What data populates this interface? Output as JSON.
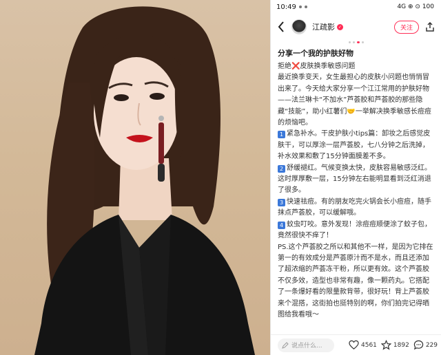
{
  "status_bar": {
    "time": "10:49",
    "right_indicators": "4G ⊕ ⊙ 100"
  },
  "header": {
    "author_name": "江疏影",
    "follow_label": "关注"
  },
  "post": {
    "title": "分享一个我的护肤好物",
    "paragraphs": [
      {
        "pre": "拒绝",
        "emoji": "❌",
        "text": "皮肤换季敏感问题"
      },
      {
        "text": "最近换季变天，女生最担心的皮肤小问题也悄悄冒出来了。今天给大家分享一个江江常用的护肤好物——法兰琳卡“不加水”芦荟胶和芦荟胶的那些隐藏“技能”，助小红薯们"
      },
      {
        "wink": "🤝",
        "text": "一举解决换季敏感长痘痘的烦恼吧。"
      },
      {
        "num": "1",
        "text": "紧急补水。干皮护肤小tips篇：卸妆之后感觉皮肤干，可以厚涂一层芦荟胶，七八分钟之后洗掉，补水效果和敷了15分钟面膜差不多。"
      },
      {
        "num": "2",
        "text": "舒缓褪红。气候变换太快，皮肤容易敏感泛红。这时厚厚敷一层，15分钟左右能明显看到泛红消退了很多。"
      },
      {
        "num": "3",
        "text": "快速祛痘。有的朋友吃完火锅会长小痘痘，随手抹点芦荟胶，可以缓解哦。"
      },
      {
        "num": "4",
        "text": "蚊虫叮咬。意外发现！涂痘痘顺便涂了蚊子包，竟然很快不痒了！"
      },
      {
        "text": "PS.这个芦荟胶之所以和其他不一样，是因为它排在第一的有效成分是芦荟原汁而不是水，而且还添加了超浓缩的芦荟冻干粉，所以更有效。这个芦荟胶不仅多效，造型也非常有趣，像一颗药丸。它搭配了一条爆好看的限量款背带，很好玩！背上芦荟胶来个混搭，这街拍也挺特别的啊，你们拍完记得晒图给我看哦～"
      }
    ]
  },
  "bottom_bar": {
    "comment_placeholder": "说点什么...",
    "likes": "4561",
    "stars": "1892",
    "comments": "229"
  },
  "colors": {
    "accent": "#ff2d55",
    "number_badge": "#3b78d9",
    "photo_background": "#d6bd9d"
  },
  "icons": [
    "back-arrow-icon",
    "share-icon",
    "pencil-icon",
    "heart-icon",
    "star-icon",
    "comment-icon",
    "verified-badge-icon"
  ]
}
